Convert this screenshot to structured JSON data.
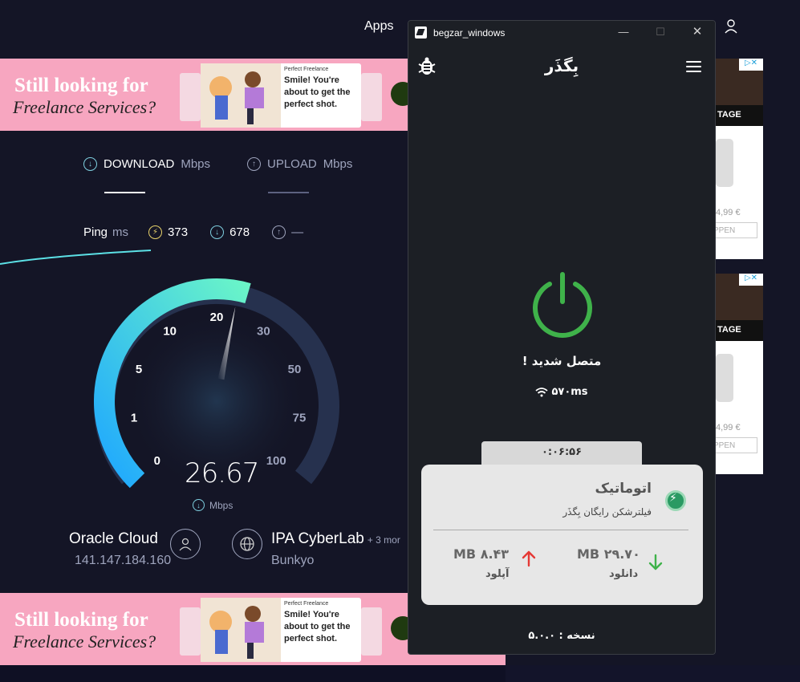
{
  "browser": {
    "apps_label": "Apps"
  },
  "ads": {
    "headline1": "Still looking for",
    "headline2": "Freelance Services?",
    "card_brand": "Perfect Freelance",
    "card_message": "Smile! You're about to get the perfect shot.",
    "side_label": "TAGE",
    "side_price": "4,99 €",
    "side_button": "PPEN"
  },
  "speedtest": {
    "tabs": [
      {
        "label": "DOWNLOAD",
        "unit": "Mbps"
      },
      {
        "label": "UPLOAD",
        "unit": "Mbps"
      }
    ],
    "ping_label": "Ping",
    "ping_unit": "ms",
    "ping_value": "373",
    "download_ping": "678",
    "upload_ping": "—",
    "gauge_ticks": [
      "0",
      "1",
      "5",
      "10",
      "20",
      "30",
      "50",
      "75",
      "100"
    ],
    "readout": "26.67",
    "readout_unit": "Mbps",
    "gauge_value_fraction": 0.56,
    "provider_name": "Oracle Cloud",
    "provider_ip": "141.147.184.160",
    "server_name": "IPA CyberLab",
    "server_more": "+ 3 mor",
    "server_location": "Bunkyo"
  },
  "window": {
    "title": "begzar_windows",
    "min_icon": "—",
    "max_icon": "☐",
    "close_icon": "✕"
  },
  "app": {
    "title": "بِگذَر",
    "status": "متصل شدید !",
    "ping": "۵۷۰ms",
    "timer": "۰:۰۶:۵۶",
    "card_title": "اتوماتیک",
    "card_subtitle": "فیلترشکن رایگان بِگذَر",
    "download_value": "MB ۲۹.۷۰",
    "download_label": "دانلود",
    "upload_value": "MB ۸.۴۳",
    "upload_label": "آپلود",
    "version": "نسخه : ۵.۰.۰",
    "accent_color": "#3fb24a"
  }
}
